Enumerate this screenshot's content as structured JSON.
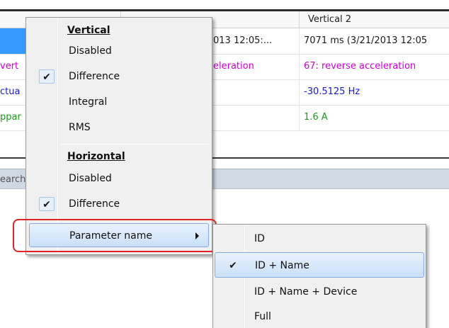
{
  "table": {
    "header_col3": "Vertical 2",
    "rows": [
      {
        "col1": "",
        "col2": "013 12:05:...",
        "col3": "7071 ms (3/21/2013 12:05"
      },
      {
        "col1": "vert",
        "col2": "eleration",
        "col3": "67: reverse acceleration"
      },
      {
        "col1": "ctua",
        "col2": "",
        "col3": "-30.5125 Hz"
      },
      {
        "col1": "ppar",
        "col2": "",
        "col3": "1.6 A"
      }
    ],
    "row_colors": [
      "#1a1a1a",
      "#cc00cc",
      "#1a1acc",
      "#1a9a1a"
    ]
  },
  "searchbar": {
    "hint": "earch"
  },
  "main_menu": {
    "vertical_title": "Vertical",
    "vertical_items": [
      {
        "label": "Disabled",
        "checked": false
      },
      {
        "label": "Difference",
        "checked": true
      },
      {
        "label": "Integral",
        "checked": false
      },
      {
        "label": "RMS",
        "checked": false
      }
    ],
    "horizontal_title": "Horizontal",
    "horizontal_items": [
      {
        "label": "Disabled",
        "checked": false
      },
      {
        "label": "Difference",
        "checked": true
      }
    ],
    "param_label": "Parameter name",
    "check_glyph": "✔"
  },
  "sub_menu": {
    "items": [
      {
        "label": "ID",
        "checked": false
      },
      {
        "label": "ID + Name",
        "checked": true
      },
      {
        "label": "ID + Name + Device",
        "checked": false
      },
      {
        "label": "Full",
        "checked": false
      }
    ]
  },
  "colors": {
    "selection_blue": "#3399ff",
    "callout_red": "#e02424",
    "menu_bg": "#f0f0f0",
    "highlight_border": "#84acdd"
  }
}
